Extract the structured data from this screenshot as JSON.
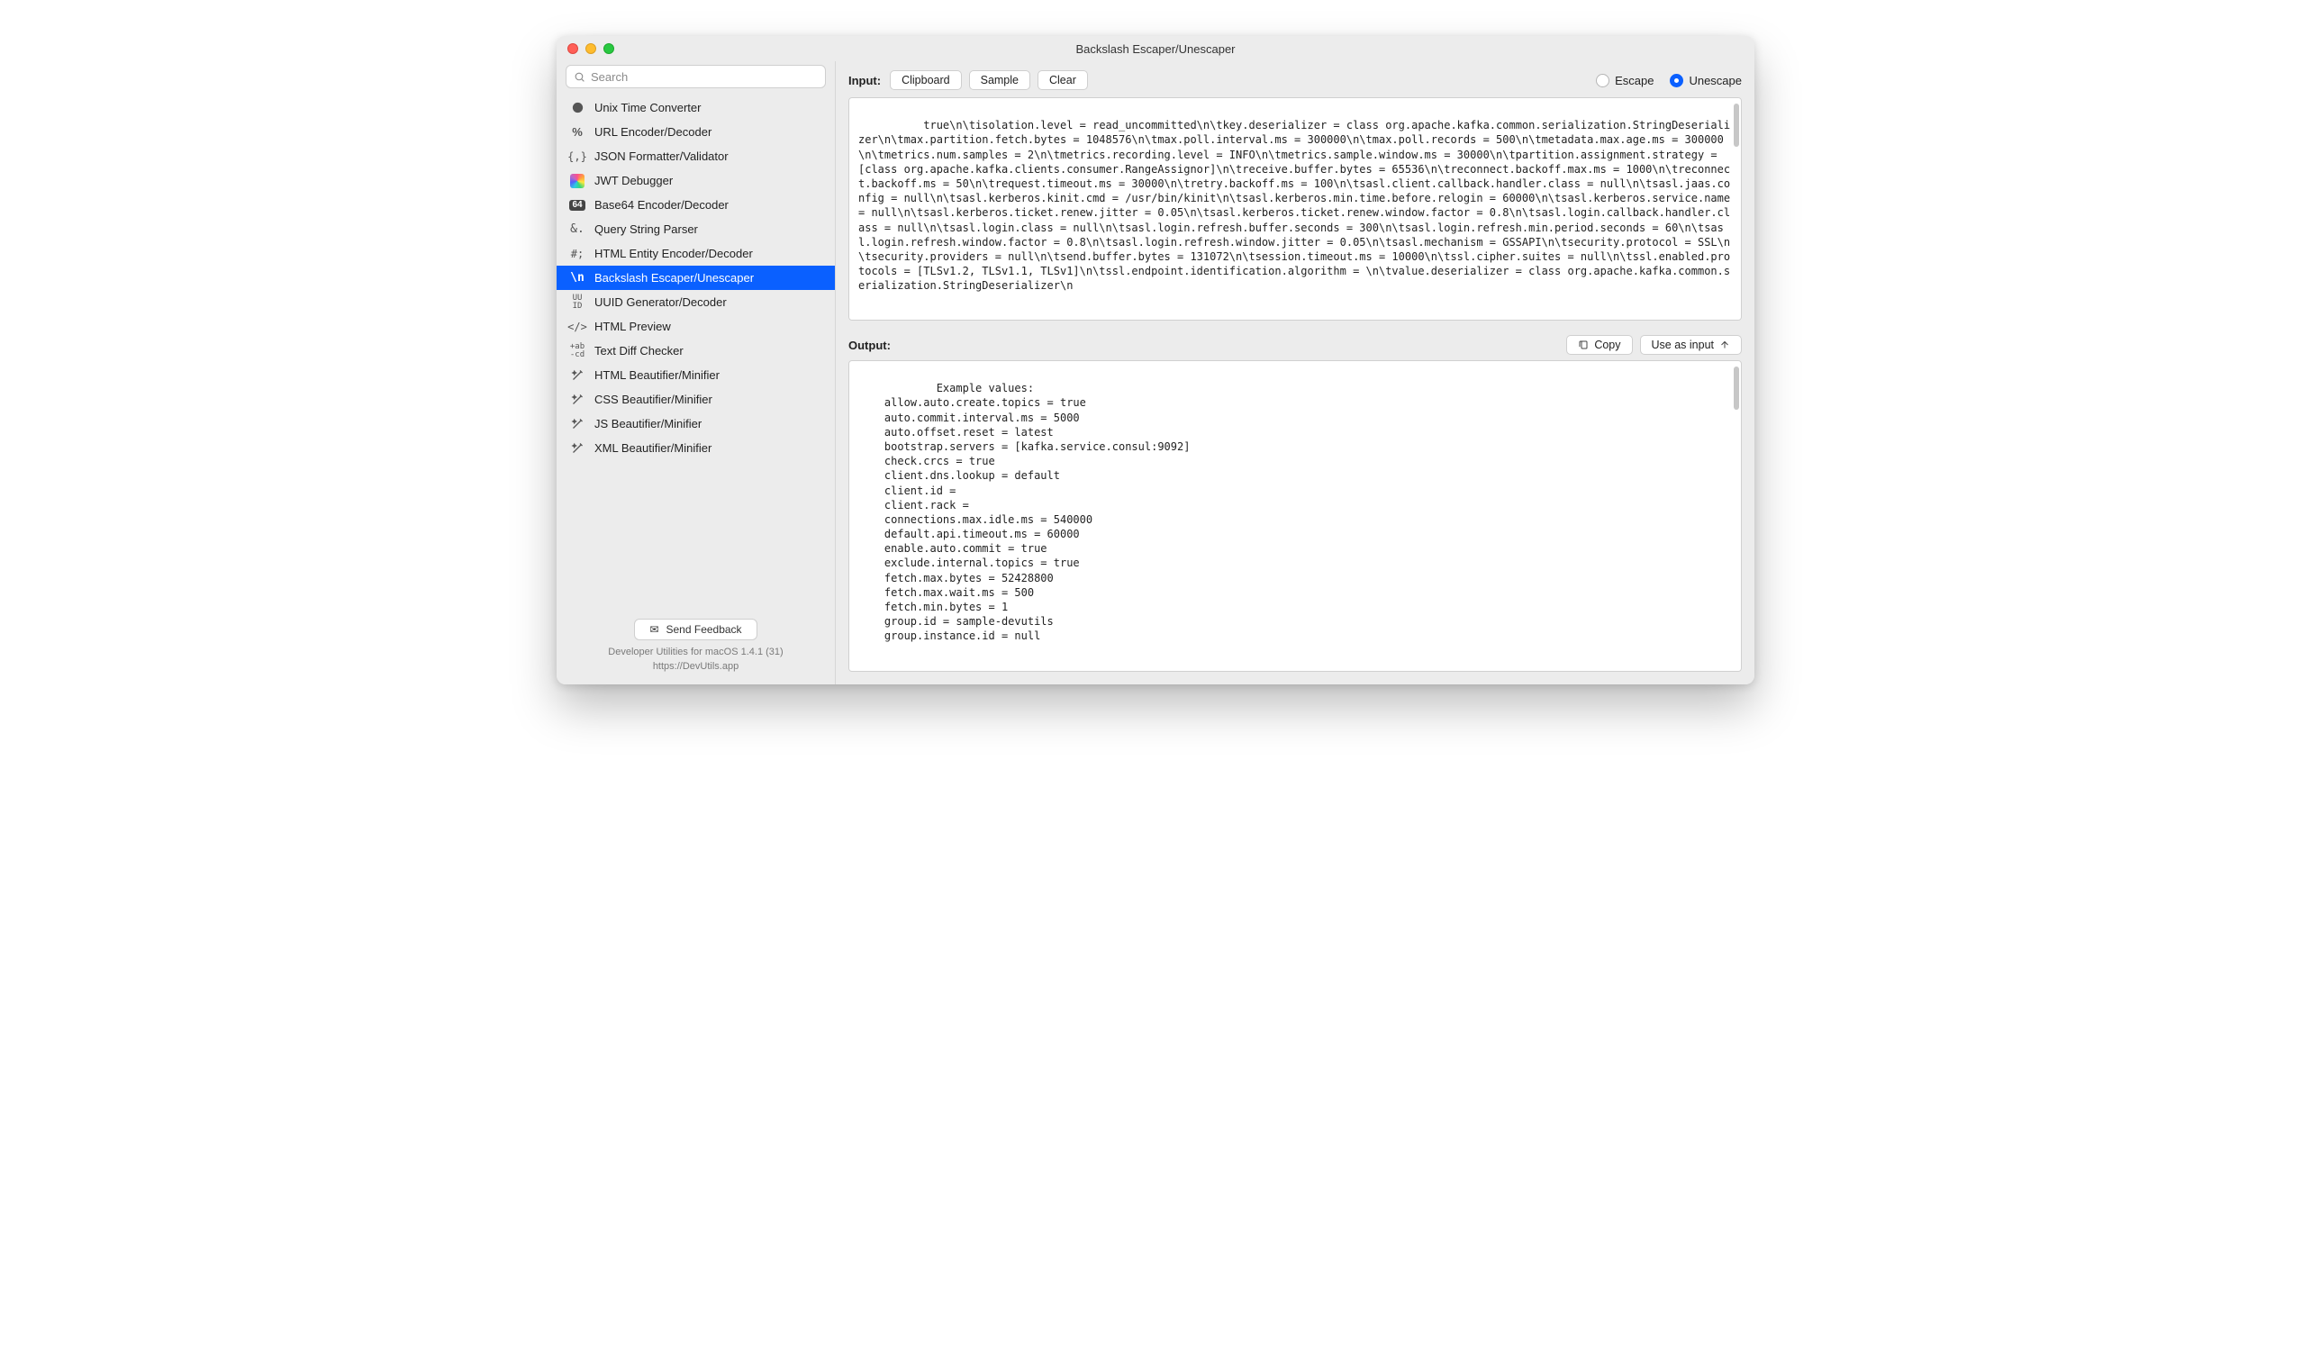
{
  "window": {
    "title": "Backslash Escaper/Unescaper"
  },
  "search": {
    "placeholder": "Search"
  },
  "sidebar": {
    "items": [
      {
        "icon": "clock-icon",
        "label": "Unix Time Converter"
      },
      {
        "icon": "percent-icon",
        "label": "URL Encoder/Decoder"
      },
      {
        "icon": "braces-icon",
        "label": "JSON Formatter/Validator"
      },
      {
        "icon": "jwt-icon",
        "label": "JWT Debugger"
      },
      {
        "icon": "badge64-icon",
        "label": "Base64 Encoder/Decoder"
      },
      {
        "icon": "ampersand-icon",
        "label": "Query String Parser"
      },
      {
        "icon": "hash-icon",
        "label": "HTML Entity Encoder/Decoder"
      },
      {
        "icon": "backslash-icon",
        "label": "Backslash Escaper/Unescaper",
        "selected": true
      },
      {
        "icon": "uuid-icon",
        "label": "UUID Generator/Decoder"
      },
      {
        "icon": "code-icon",
        "label": "HTML Preview"
      },
      {
        "icon": "diff-icon",
        "label": "Text Diff Checker"
      },
      {
        "icon": "wand-icon",
        "label": "HTML Beautifier/Minifier"
      },
      {
        "icon": "wand-icon",
        "label": "CSS Beautifier/Minifier"
      },
      {
        "icon": "wand-icon",
        "label": "JS Beautifier/Minifier"
      },
      {
        "icon": "wand-icon",
        "label": "XML Beautifier/Minifier"
      }
    ]
  },
  "feedback": {
    "label": "Send Feedback"
  },
  "footer": {
    "line1": "Developer Utilities for macOS 1.4.1 (31)",
    "line2": "https://DevUtils.app"
  },
  "input": {
    "label": "Input:",
    "buttons": {
      "clipboard": "Clipboard",
      "sample": "Sample",
      "clear": "Clear"
    },
    "modes": {
      "escape": "Escape",
      "unescape": "Unescape",
      "selected": "unescape"
    },
    "text": "true\\n\\tisolation.level = read_uncommitted\\n\\tkey.deserializer = class org.apache.kafka.common.serialization.StringDeserializer\\n\\tmax.partition.fetch.bytes = 1048576\\n\\tmax.poll.interval.ms = 300000\\n\\tmax.poll.records = 500\\n\\tmetadata.max.age.ms = 300000\\n\\tmetrics.num.samples = 2\\n\\tmetrics.recording.level = INFO\\n\\tmetrics.sample.window.ms = 30000\\n\\tpartition.assignment.strategy = [class org.apache.kafka.clients.consumer.RangeAssignor]\\n\\treceive.buffer.bytes = 65536\\n\\treconnect.backoff.max.ms = 1000\\n\\treconnect.backoff.ms = 50\\n\\trequest.timeout.ms = 30000\\n\\tretry.backoff.ms = 100\\n\\tsasl.client.callback.handler.class = null\\n\\tsasl.jaas.config = null\\n\\tsasl.kerberos.kinit.cmd = /usr/bin/kinit\\n\\tsasl.kerberos.min.time.before.relogin = 60000\\n\\tsasl.kerberos.service.name = null\\n\\tsasl.kerberos.ticket.renew.jitter = 0.05\\n\\tsasl.kerberos.ticket.renew.window.factor = 0.8\\n\\tsasl.login.callback.handler.class = null\\n\\tsasl.login.class = null\\n\\tsasl.login.refresh.buffer.seconds = 300\\n\\tsasl.login.refresh.min.period.seconds = 60\\n\\tsasl.login.refresh.window.factor = 0.8\\n\\tsasl.login.refresh.window.jitter = 0.05\\n\\tsasl.mechanism = GSSAPI\\n\\tsecurity.protocol = SSL\\n\\tsecurity.providers = null\\n\\tsend.buffer.bytes = 131072\\n\\tsession.timeout.ms = 10000\\n\\tssl.cipher.suites = null\\n\\tssl.enabled.protocols = [TLSv1.2, TLSv1.1, TLSv1]\\n\\tssl.endpoint.identification.algorithm = \\n\\tvalue.deserializer = class org.apache.kafka.common.serialization.StringDeserializer\\n"
  },
  "output": {
    "label": "Output:",
    "buttons": {
      "copy": "Copy",
      "use_as_input": "Use as input"
    },
    "text": "Example values:\n    allow.auto.create.topics = true\n    auto.commit.interval.ms = 5000\n    auto.offset.reset = latest\n    bootstrap.servers = [kafka.service.consul:9092]\n    check.crcs = true\n    client.dns.lookup = default\n    client.id = \n    client.rack = \n    connections.max.idle.ms = 540000\n    default.api.timeout.ms = 60000\n    enable.auto.commit = true\n    exclude.internal.topics = true\n    fetch.max.bytes = 52428800\n    fetch.max.wait.ms = 500\n    fetch.min.bytes = 1\n    group.id = sample-devutils\n    group.instance.id = null"
  }
}
